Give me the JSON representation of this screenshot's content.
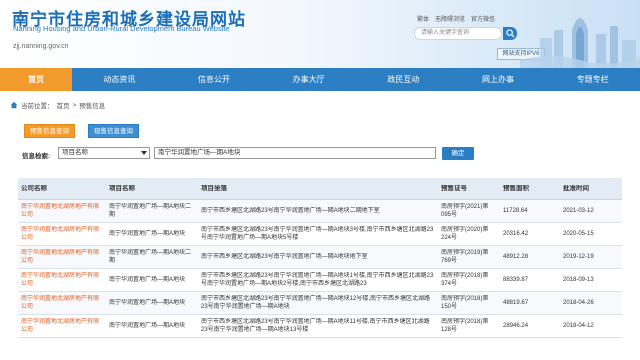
{
  "header": {
    "title_cn": "南宁市住房和城乡建设局网站",
    "title_en_line1": "Nanning Housing and Urban-Rural Development Bureau Website",
    "title_en_line2": "",
    "url": "zjj.nanning.gov.cn",
    "top_links": [
      "繁体",
      "无障碍浏览",
      "官方微信"
    ],
    "search_placeholder": "请输入关键字查询",
    "ipv6_label": "网站支持IPV6"
  },
  "nav": {
    "items": [
      "首页",
      "动态资讯",
      "信息公开",
      "办事大厅",
      "政民互动",
      "网上办事",
      "专题专栏"
    ],
    "active_index": 0
  },
  "breadcrumb": {
    "prefix": "当前位置：",
    "home": "首页",
    "sep": ">",
    "current": "预售信息"
  },
  "filter": {
    "tab1": "预售信息查询",
    "tab2": "现售信息查询",
    "label": "信息检索:",
    "select_value": "项目名称",
    "input_value": "南宁华润置地广场—期A地块",
    "confirm": "确定"
  },
  "table": {
    "headers": [
      "公司名称",
      "项目名称",
      "项目坐落",
      "预售证号",
      "预售面积",
      "批准时间"
    ],
    "rows": [
      [
        "南宁华润置地北湖房地产有限公司",
        "南宁华润置地广场—期A地块二期",
        "南宁市西乡塘区北湖路23号南宁华润置地广场—期A地块二期地下室",
        "南房预字(2021)第095号",
        "11728.64",
        "2021-03-12"
      ],
      [
        "南宁华润置地北湖房地产有限公司",
        "南宁华润置地广场—期A地块",
        "南宁市西乡塘区北湖路23号南宁华润置地广场—期A地块3号楼,南宁市西乡塘区北湖路23号南宁华润置地广场—期A地块5号楼",
        "南房预字(2020)第224号",
        "20316.42",
        "2020-05-15"
      ],
      [
        "南宁华润置地北湖房地产有限公司",
        "南宁华润置地广场—期A地块二期",
        "南宁市西乡塘区北湖路23号南宁华润置地广场—期A地块地下室",
        "南房预字(2019)第769号",
        "48912.28",
        "2019-12-19"
      ],
      [
        "南宁华润置地北湖房地产有限公司",
        "南宁华润置地广场—期A地块",
        "南宁市西乡塘区北湖路23号南宁华润置地广场—期A地块1号楼,南宁市西乡塘区北湖路23号南宁华润置地广场—期A地块2号楼,南宁市西乡塘区北湖路23",
        "南房预字(2018)第374号",
        "88339.87",
        "2018-09-13"
      ],
      [
        "南宁华润置地北湖房地产有限公司",
        "南宁华润置地广场—期A地块",
        "南宁市西乡塘区北湖路23号南宁华润置地广场—期A地块12号楼,南宁市西乡塘区北湖路23号南宁华润置地广场—期A地块",
        "南房预字(2018)第150号",
        "48819.67",
        "2018-04-26"
      ],
      [
        "南宁华润置地北湖房地产有限公司",
        "南宁华润置地广场—期A地块",
        "南宁市西乡塘区北湖路23号南宁华润置地广场—期A地块11号楼,南宁市西乡塘区北湖路23号南宁华润置地广场—期A地块13号楼",
        "南房预字(2018)第128号",
        "28946.24",
        "2018-04-12"
      ]
    ]
  },
  "colors": {
    "primary_blue": "#2d7fc4",
    "accent_orange": "#f29b2c",
    "company_text": "#e25b1e"
  }
}
